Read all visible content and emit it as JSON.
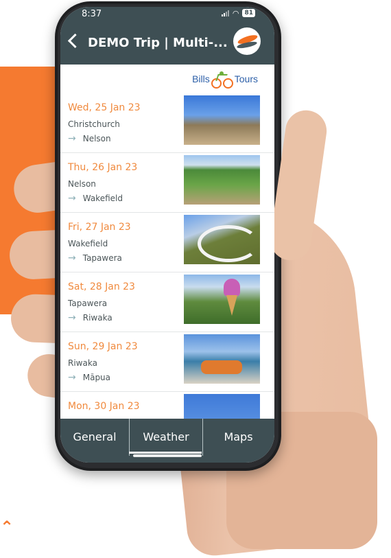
{
  "status_bar": {
    "time": "8:37",
    "battery": "81"
  },
  "header": {
    "title": "DEMO Trip | Multi-..."
  },
  "brand": {
    "name_left": "Bills",
    "name_right": "Tours"
  },
  "itinerary": [
    {
      "date": "Wed, 25 Jan 23",
      "from": "Christchurch",
      "to": "Nelson"
    },
    {
      "date": "Thu, 26 Jan 23",
      "from": "Nelson",
      "to": "Wakefield"
    },
    {
      "date": "Fri, 27 Jan 23",
      "from": "Wakefield",
      "to": "Tapawera"
    },
    {
      "date": "Sat, 28 Jan 23",
      "from": "Tapawera",
      "to": "Riwaka"
    },
    {
      "date": "Sun, 29 Jan 23",
      "from": "Riwaka",
      "to": "Māpua"
    },
    {
      "date": "Mon, 30 Jan 23",
      "from": "",
      "to": ""
    }
  ],
  "tabs": {
    "general": "General",
    "weather": "Weather",
    "maps": "Maps",
    "active": "Weather"
  },
  "colors": {
    "header": "#3e4f54",
    "date_accent": "#f08a3e",
    "background_block": "#f57a30"
  }
}
